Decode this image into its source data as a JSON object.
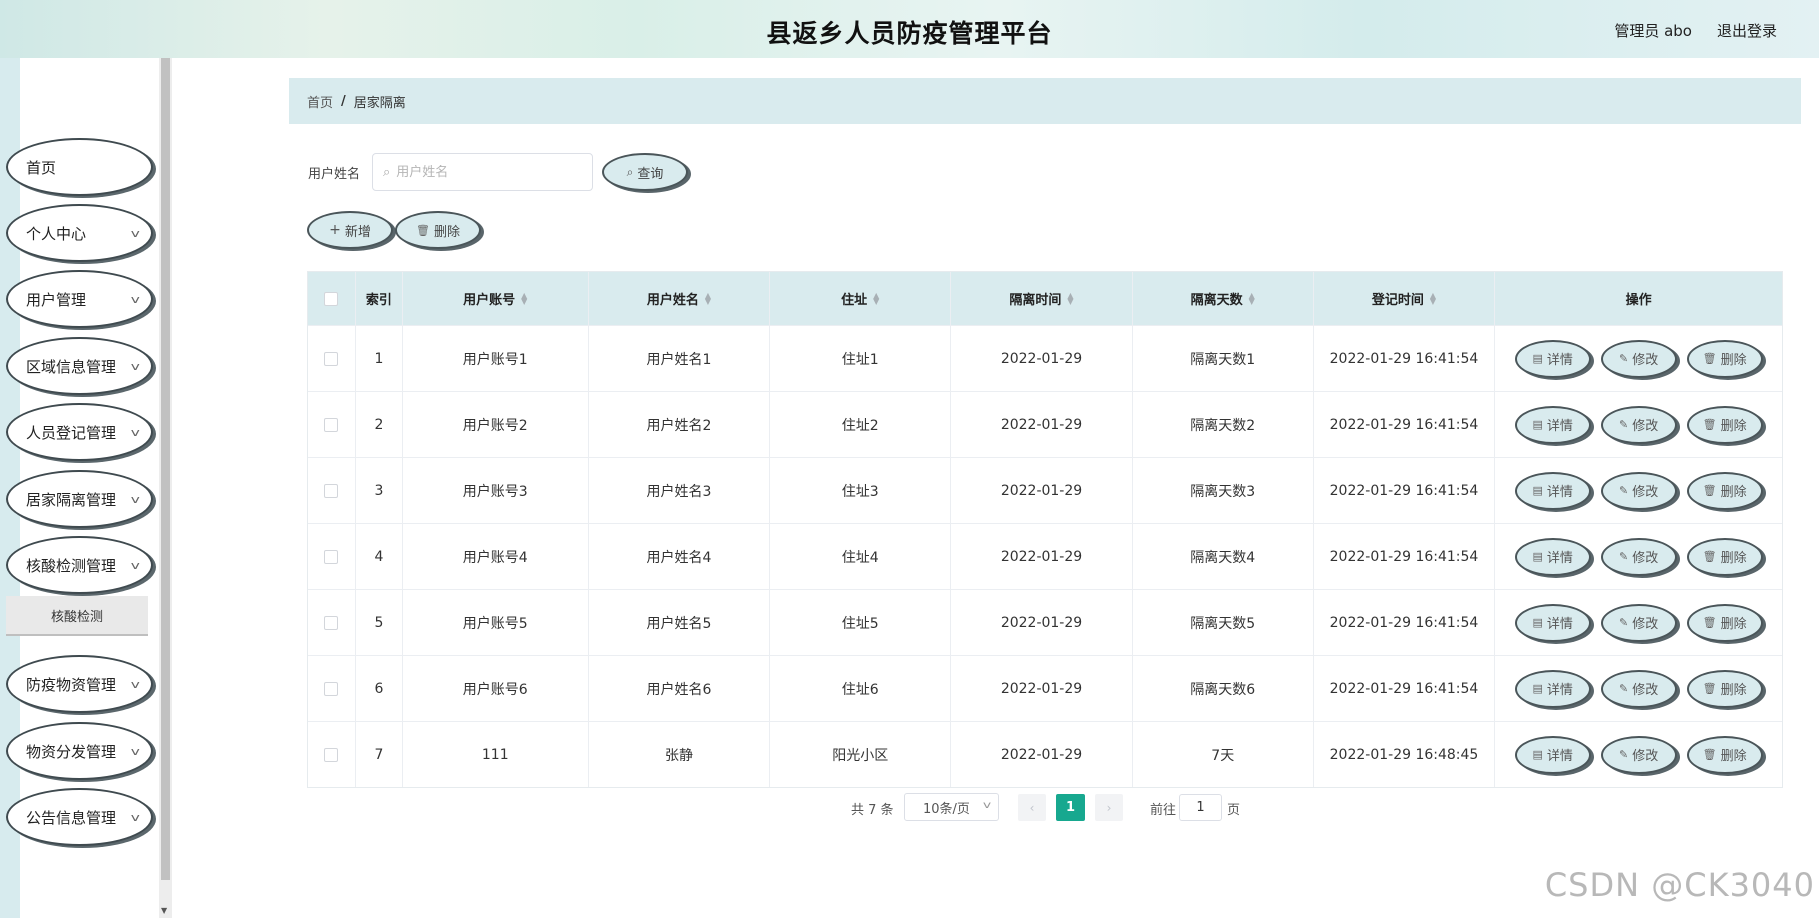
{
  "header": {
    "title": "县返乡人员防疫管理平台",
    "user": "管理员 abo",
    "logout": "退出登录"
  },
  "sidebar": {
    "items": [
      {
        "label": "首页",
        "expandable": false
      },
      {
        "label": "个人中心",
        "expandable": true
      },
      {
        "label": "用户管理",
        "expandable": true
      },
      {
        "label": "区域信息管理",
        "expandable": true
      },
      {
        "label": "人员登记管理",
        "expandable": true
      },
      {
        "label": "居家隔离管理",
        "expandable": true
      },
      {
        "label": "核酸检测管理",
        "expandable": true
      },
      {
        "label": "防疫物资管理",
        "expandable": true
      },
      {
        "label": "物资分发管理",
        "expandable": true
      },
      {
        "label": "公告信息管理",
        "expandable": true
      }
    ],
    "submenu_label": "核酸检测"
  },
  "breadcrumb": {
    "home": "首页",
    "separator": "/",
    "current": "居家隔离"
  },
  "search": {
    "label": "用户姓名",
    "placeholder": "用户姓名",
    "value": "",
    "button": "查询"
  },
  "toolbar": {
    "add": "新增",
    "delete": "删除"
  },
  "table": {
    "headers": {
      "index": "索引",
      "account": "用户账号",
      "name": "用户姓名",
      "address": "住址",
      "time": "隔离时间",
      "days": "隔离天数",
      "registered": "登记时间",
      "ops": "操作"
    },
    "ops": {
      "detail": "详情",
      "edit": "修改",
      "delete": "删除"
    },
    "rows": [
      {
        "index": "1",
        "account": "用户账号1",
        "name": "用户姓名1",
        "address": "住址1",
        "time": "2022-01-29",
        "days": "隔离天数1",
        "registered": "2022-01-29 16:41:54"
      },
      {
        "index": "2",
        "account": "用户账号2",
        "name": "用户姓名2",
        "address": "住址2",
        "time": "2022-01-29",
        "days": "隔离天数2",
        "registered": "2022-01-29 16:41:54"
      },
      {
        "index": "3",
        "account": "用户账号3",
        "name": "用户姓名3",
        "address": "住址3",
        "time": "2022-01-29",
        "days": "隔离天数3",
        "registered": "2022-01-29 16:41:54"
      },
      {
        "index": "4",
        "account": "用户账号4",
        "name": "用户姓名4",
        "address": "住址4",
        "time": "2022-01-29",
        "days": "隔离天数4",
        "registered": "2022-01-29 16:41:54"
      },
      {
        "index": "5",
        "account": "用户账号5",
        "name": "用户姓名5",
        "address": "住址5",
        "time": "2022-01-29",
        "days": "隔离天数5",
        "registered": "2022-01-29 16:41:54"
      },
      {
        "index": "6",
        "account": "用户账号6",
        "name": "用户姓名6",
        "address": "住址6",
        "time": "2022-01-29",
        "days": "隔离天数6",
        "registered": "2022-01-29 16:41:54"
      },
      {
        "index": "7",
        "account": "111",
        "name": "张静",
        "address": "阳光小区",
        "time": "2022-01-29",
        "days": "7天",
        "registered": "2022-01-29 16:48:45"
      }
    ]
  },
  "pagination": {
    "total": "共 7 条",
    "page_size": "10条/页",
    "current_page": "1",
    "goto_prefix": "前往",
    "goto_value": "1",
    "goto_suffix": "页"
  },
  "watermark": "CSDN @CK3040",
  "colors": {
    "accent": "#17a88f",
    "panel": "#d9ebee"
  }
}
